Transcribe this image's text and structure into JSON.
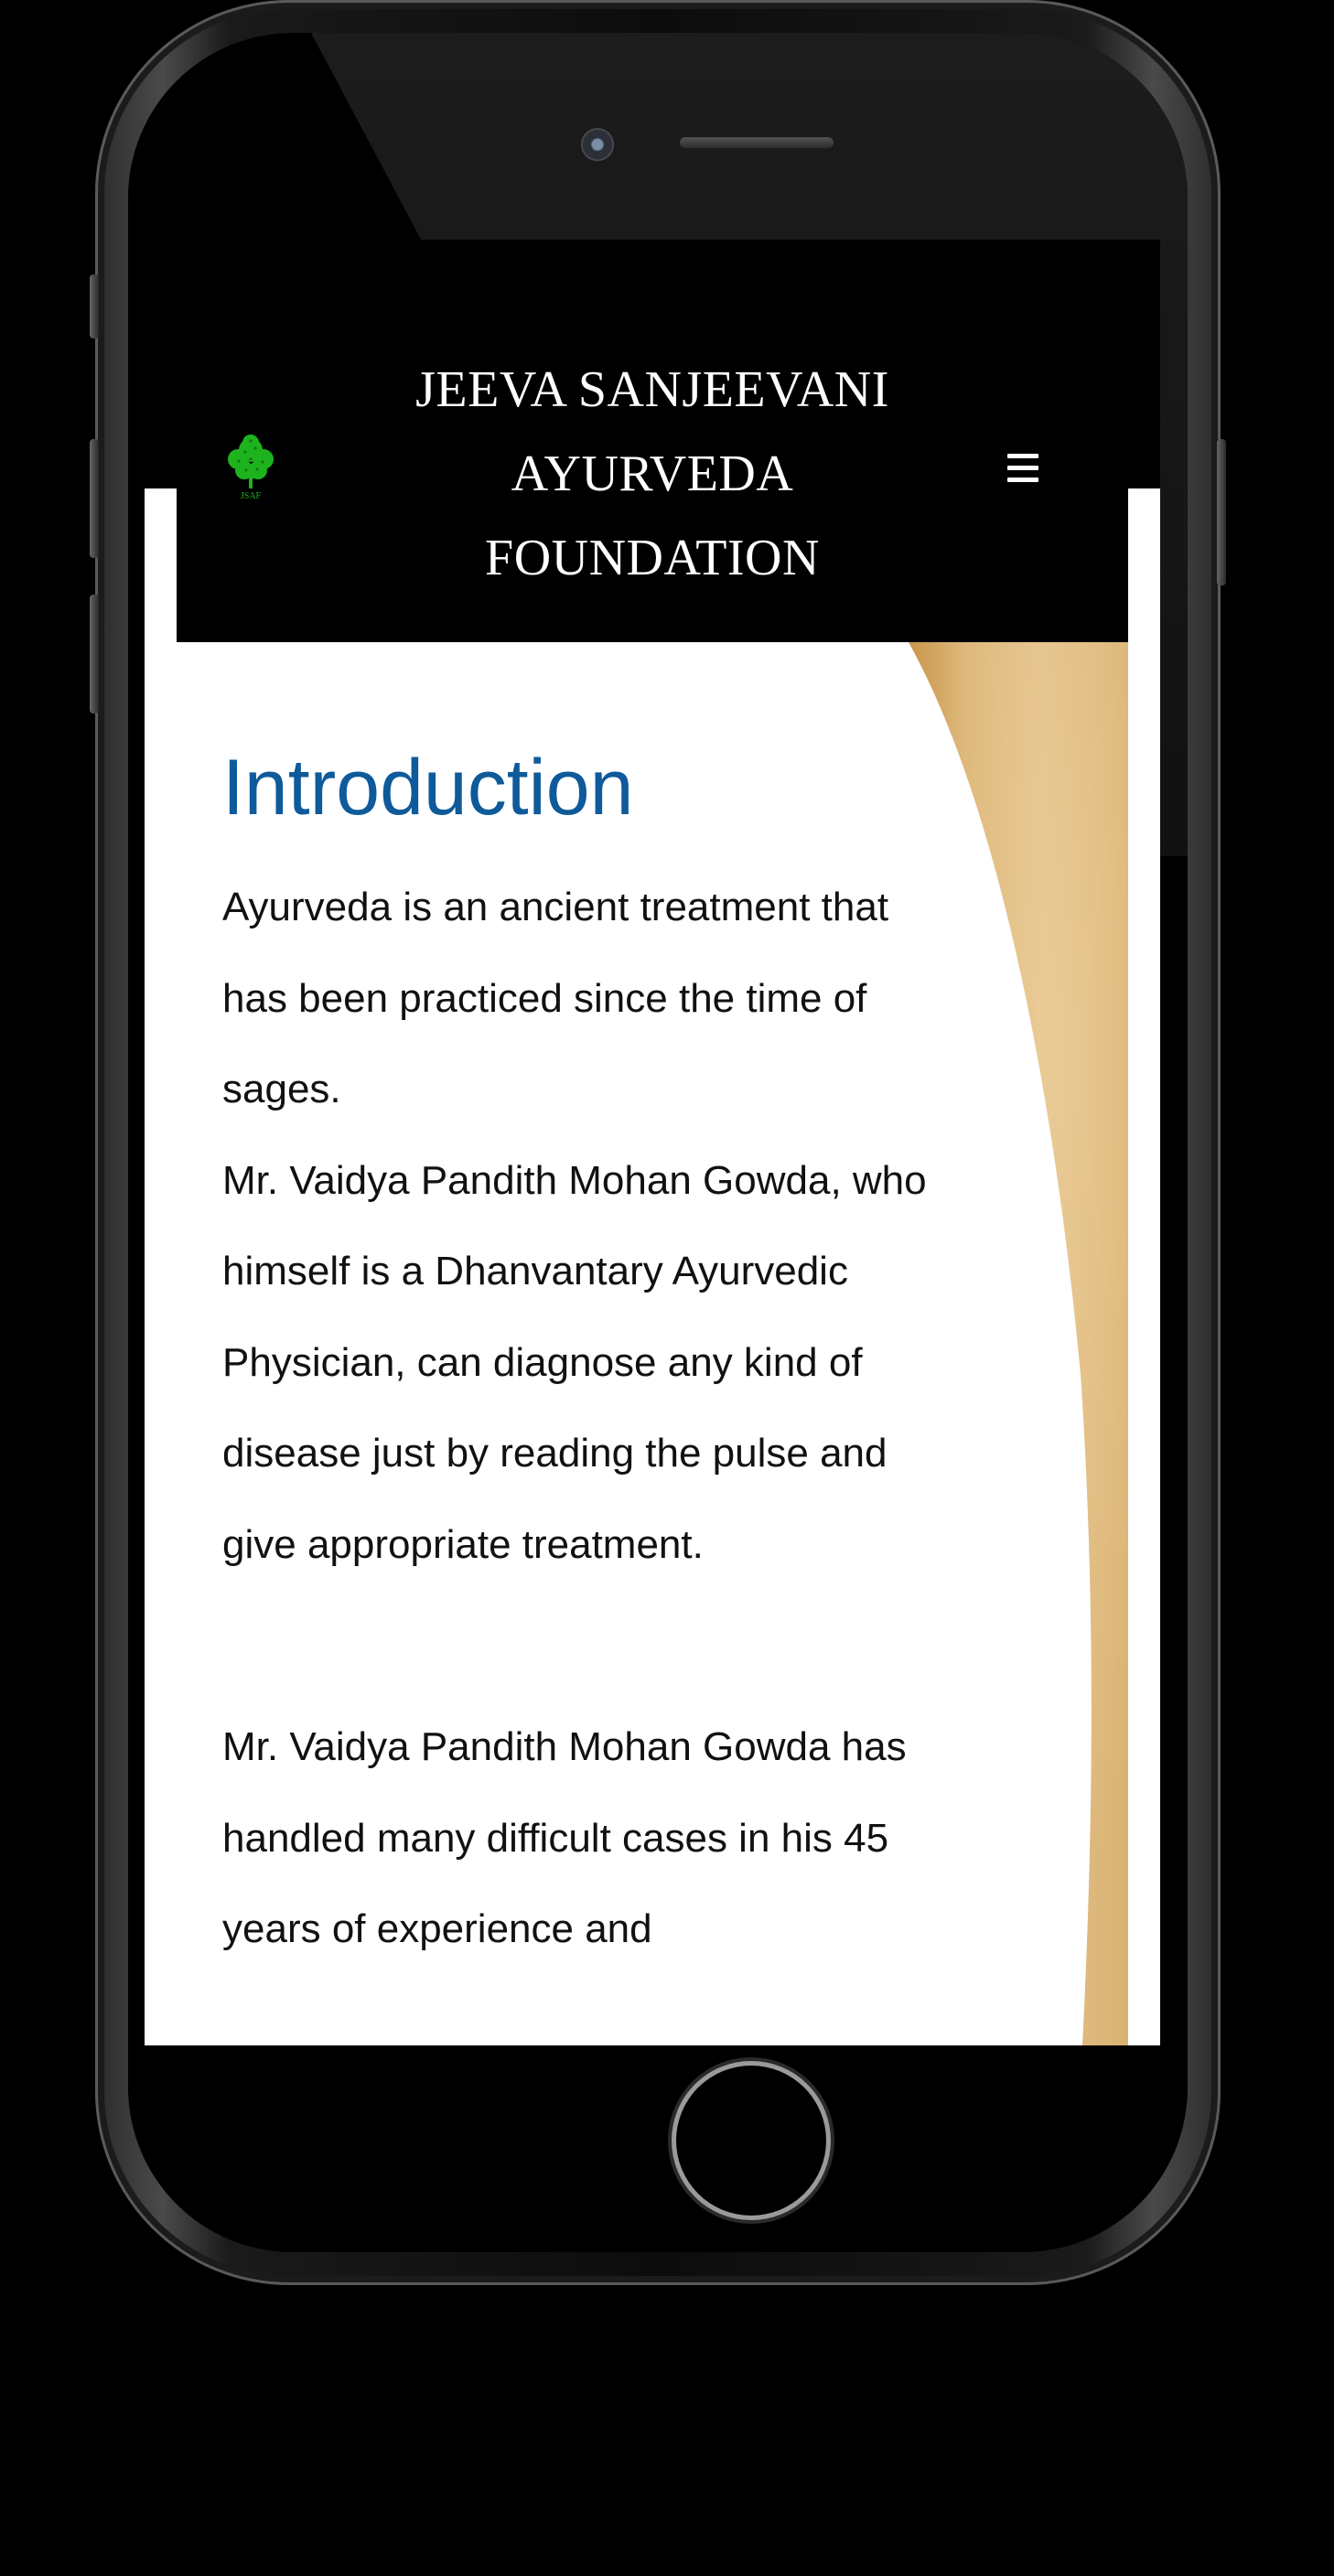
{
  "site": {
    "title": "JEEVA SANJEEVANI AYURVEDA FOUNDATION",
    "logo_text": "JSAF",
    "menu_icon": "hamburger-menu-icon"
  },
  "content": {
    "heading": "Introduction",
    "paragraph_1": "Ayurveda is an ancient treatment that has been practiced since the time of sages.",
    "paragraph_1b": "Mr. Vaidya Pandith Mohan Gowda, who himself is a Dhanvantary Ayurvedic Physician, can diagnose any kind of disease just by reading the pulse and give appropriate treatment.",
    "paragraph_2": "Mr. Vaidya Pandith Mohan Gowda has handled many difficult cases in his 45 years of experience and"
  },
  "colors": {
    "header_bg": "#000000",
    "heading": "#0e5a9a",
    "decoration": "#d8b06a",
    "logo": "#1db31d"
  }
}
